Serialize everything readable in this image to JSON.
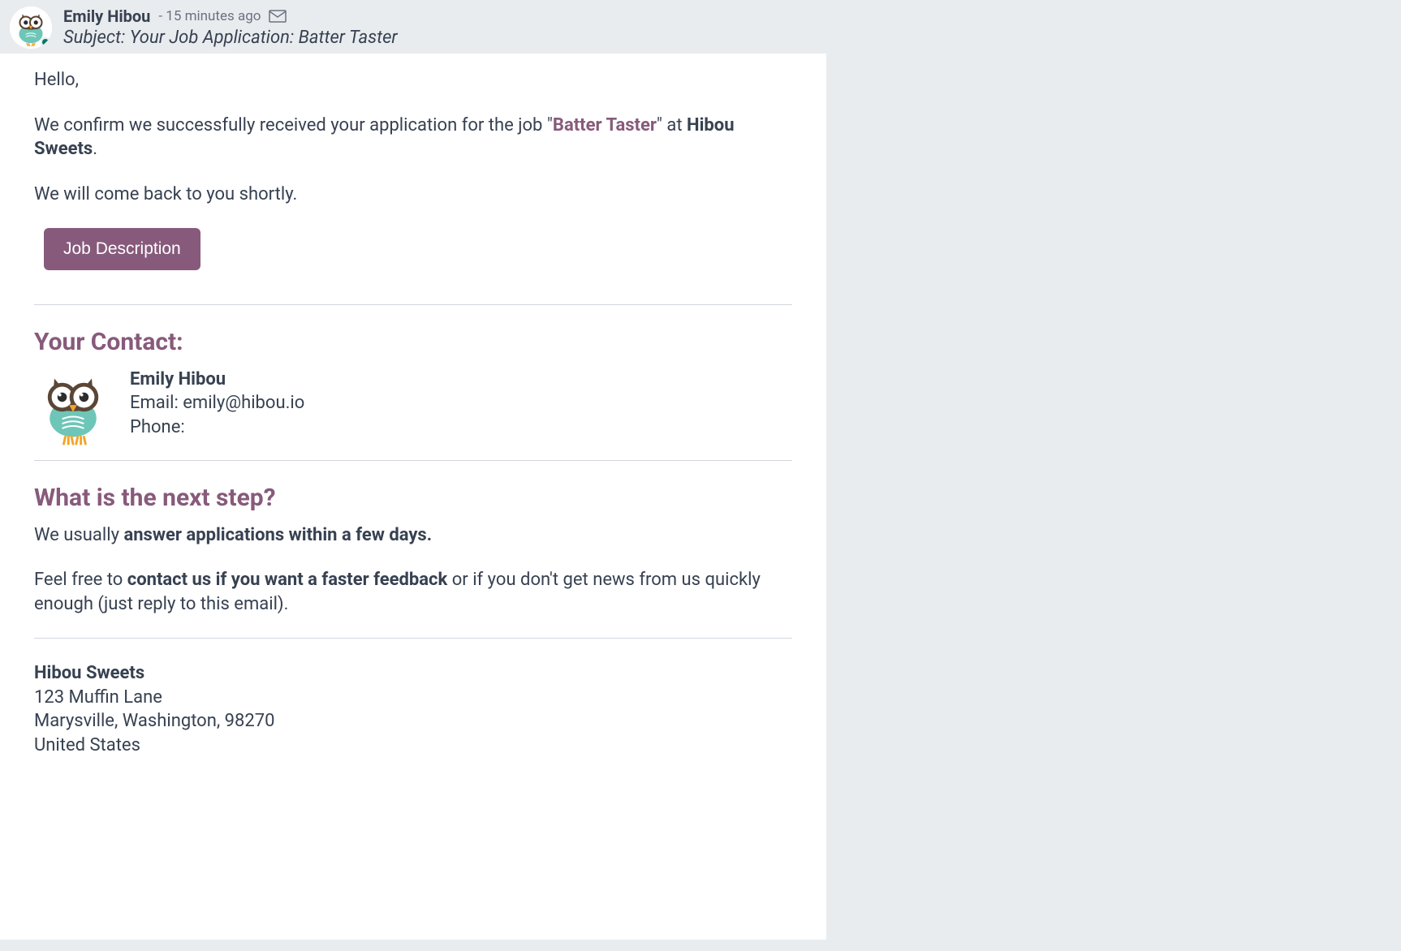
{
  "header": {
    "sender_name": "Emily Hibou",
    "timestamp": "- 15 minutes ago",
    "subject_label": "Subject:",
    "subject_value": "Your Job Application: Batter Taster"
  },
  "body": {
    "greeting": "Hello,",
    "confirm_prefix": "We confirm we successfully received your application for the job \"",
    "job_title": "Batter Taster",
    "confirm_mid": "\" at ",
    "company_name": "Hibou Sweets",
    "confirm_suffix": ".",
    "followup": "We will come back to you shortly.",
    "button_label": "Job Description"
  },
  "contact": {
    "heading": "Your Contact:",
    "name": "Emily Hibou",
    "email_label": "Email: ",
    "email_value": "emily@hibou.io",
    "phone_label": "Phone:",
    "phone_value": ""
  },
  "next_step": {
    "heading": "What is the next step?",
    "line1_prefix": "We usually ",
    "line1_strong": "answer applications within a few days.",
    "line2_prefix": "Feel free to ",
    "line2_strong": "contact us if you want a faster feedback",
    "line2_suffix": " or if you don't get news from us quickly enough (just reply to this email)."
  },
  "footer": {
    "company": "Hibou Sweets",
    "addr1": "123 Muffin Lane",
    "addr2": "Marysville, Washington, 98270",
    "addr3": "United States"
  },
  "colors": {
    "accent": "#875a7b"
  }
}
